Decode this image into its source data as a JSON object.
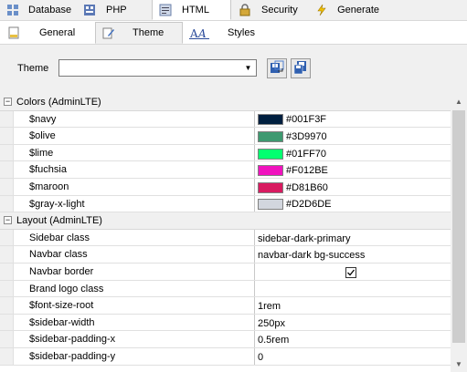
{
  "top_tabs": [
    {
      "label": "Database",
      "icon": "database-icon",
      "active": false
    },
    {
      "label": "PHP",
      "icon": "php-icon",
      "active": false
    },
    {
      "label": "HTML",
      "icon": "html-icon",
      "active": true
    },
    {
      "label": "Security",
      "icon": "lock-icon",
      "active": false
    },
    {
      "label": "Generate",
      "icon": "lightning-icon",
      "active": false
    }
  ],
  "sub_tabs": [
    {
      "label": "General",
      "icon": "document-icon",
      "active": false
    },
    {
      "label": "Theme",
      "icon": "theme-icon",
      "active": true
    },
    {
      "label": "Styles",
      "icon": "styles-icon",
      "active": false
    }
  ],
  "theme": {
    "label": "Theme",
    "value": ""
  },
  "grid": {
    "colors_category": "Colors (AdminLTE)",
    "colors": [
      {
        "name": "$navy",
        "value": "#001F3F",
        "swatch": "#001F3F"
      },
      {
        "name": "$olive",
        "value": "#3D9970",
        "swatch": "#3D9970"
      },
      {
        "name": "$lime",
        "value": "#01FF70",
        "swatch": "#01FF70"
      },
      {
        "name": "$fuchsia",
        "value": "#F012BE",
        "swatch": "#F012BE"
      },
      {
        "name": "$maroon",
        "value": "#D81B60",
        "swatch": "#D81B60"
      },
      {
        "name": "$gray-x-light",
        "value": "#D2D6DE",
        "swatch": "#D2D6DE"
      }
    ],
    "layout_category": "Layout (AdminLTE)",
    "layout": [
      {
        "name": "Sidebar class",
        "value": "sidebar-dark-primary"
      },
      {
        "name": "Navbar class",
        "value": "navbar-dark bg-success"
      },
      {
        "name": "Navbar border",
        "checked": true
      },
      {
        "name": "Brand logo class",
        "value": ""
      },
      {
        "name": "$font-size-root",
        "value": "1rem"
      },
      {
        "name": "$sidebar-width",
        "value": "250px"
      },
      {
        "name": "$sidebar-padding-x",
        "value": "0.5rem"
      },
      {
        "name": "$sidebar-padding-y",
        "value": "0"
      }
    ]
  }
}
